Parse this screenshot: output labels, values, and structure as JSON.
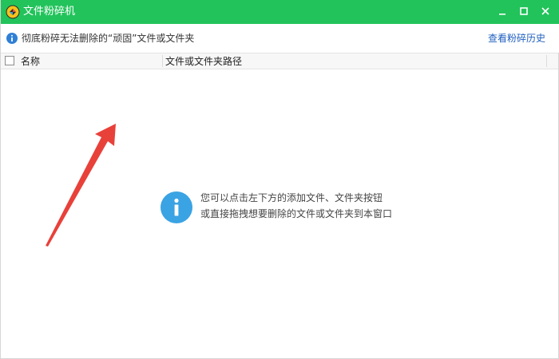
{
  "window": {
    "title": "文件粉碎机",
    "accent_color": "#22c35b"
  },
  "infobar": {
    "text": "彻底粉碎无法删除的“顽固”文件或文件夹",
    "history_link": "查看粉碎历史"
  },
  "table": {
    "columns": [
      "名称",
      "文件或文件夹路径"
    ]
  },
  "empty_state": {
    "line1": "您可以点击左下方的添加文件、文件夹按钮",
    "line2": "或直接拖拽想要删除的文件或文件夹到本窗口",
    "icon": "info-icon"
  },
  "annotation": {
    "arrow_color": "#e8413a"
  }
}
